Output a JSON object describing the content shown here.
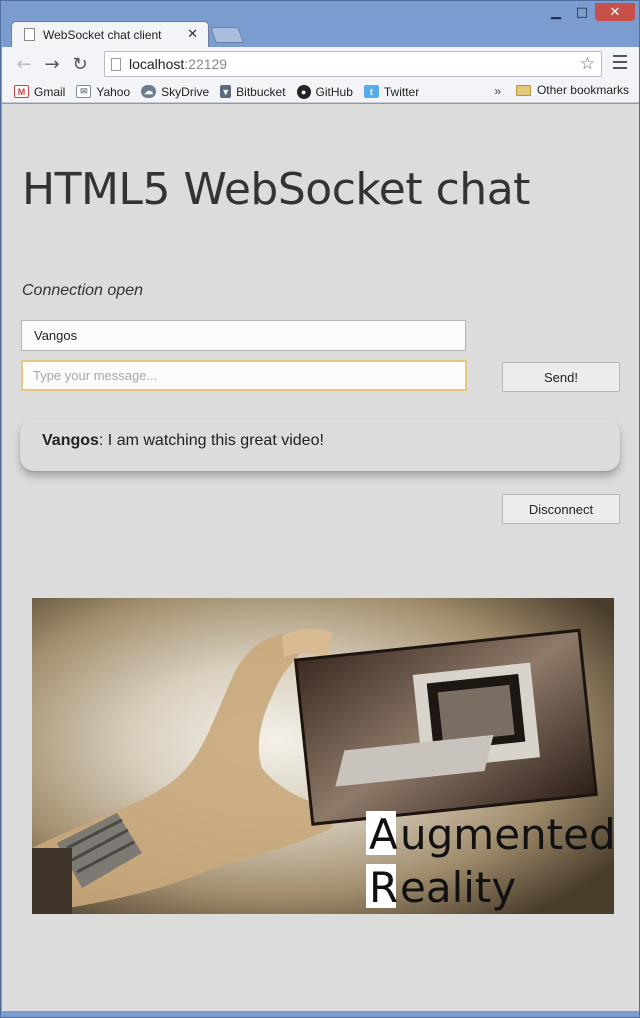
{
  "browser": {
    "tab_title": "WebSocket chat client",
    "url_host": "localhost",
    "url_port": ":22129",
    "bookmarks": [
      {
        "label": "Gmail",
        "icon": "gmail-icon",
        "color": "#d64a3c"
      },
      {
        "label": "Yahoo",
        "icon": "mail-icon",
        "color": "#7a8aa0"
      },
      {
        "label": "SkyDrive",
        "icon": "cloud-icon",
        "color": "#6d7d8e"
      },
      {
        "label": "Bitbucket",
        "icon": "bucket-icon",
        "color": "#5a6b7d"
      },
      {
        "label": "GitHub",
        "icon": "github-icon",
        "color": "#222222"
      },
      {
        "label": "Twitter",
        "icon": "twitter-icon",
        "color": "#55acee"
      }
    ],
    "more_label": "»",
    "other_bookmarks": "Other bookmarks"
  },
  "page": {
    "title": "HTML5 WebSocket chat",
    "status": "Connection open",
    "name_value": "Vangos",
    "message_placeholder": "Type your message...",
    "send_label": "Send!",
    "disconnect_label": "Disconnect",
    "messages": [
      {
        "sender": "Vangos",
        "text": ": I am watching this great video!"
      }
    ],
    "video_caption_line1": "ugmented",
    "video_caption_line2": "eality",
    "video_caption_cap1": "A",
    "video_caption_cap2": "R"
  }
}
